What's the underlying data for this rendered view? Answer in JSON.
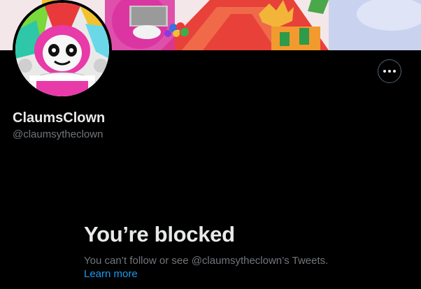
{
  "profile": {
    "display_name": "ClaumsClown",
    "handle": "@claumsytheclown"
  },
  "actions": {
    "more_icon": "more-horizontal-icon"
  },
  "blocked": {
    "title": "You’re blocked",
    "description": "You can’t follow or see @claumsytheclown’s Tweets.",
    "learn_more": "Learn more"
  },
  "colors": {
    "background": "#000000",
    "primary_text": "#e7e9ea",
    "secondary_text": "#71767b",
    "link": "#1d9bf0"
  }
}
